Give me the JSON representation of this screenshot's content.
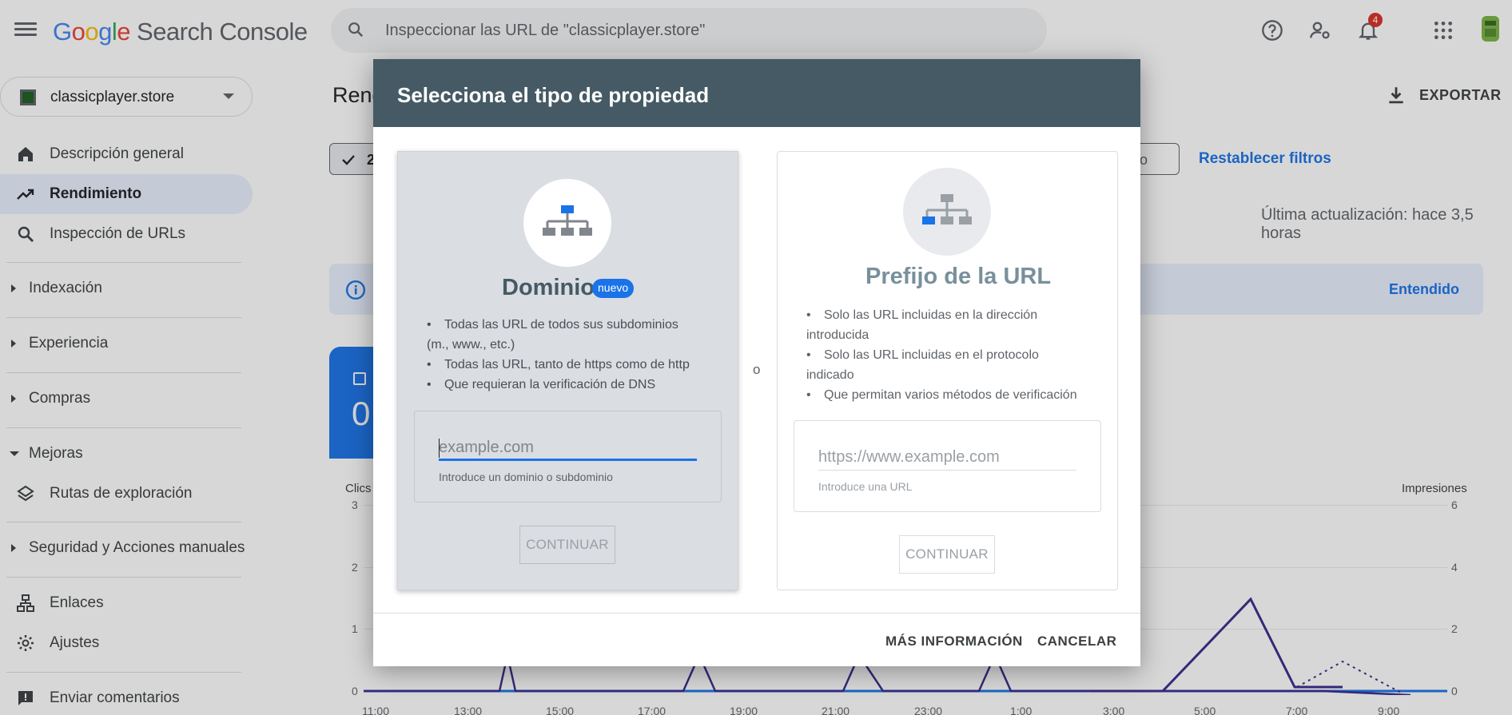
{
  "app": {
    "logo_letters": [
      "G",
      "o",
      "o",
      "g",
      "l",
      "e"
    ],
    "product": "Search Console",
    "notification_count": "4"
  },
  "search": {
    "placeholder": "Inspeccionar las URL de \"classicplayer.store\""
  },
  "property": {
    "name": "classicplayer.store"
  },
  "sidebar": {
    "items": [
      {
        "label": "Descripción general",
        "icon": "home-icon"
      },
      {
        "label": "Rendimiento",
        "icon": "trending-up-icon"
      },
      {
        "label": "Inspección de URLs",
        "icon": "search-icon"
      }
    ],
    "groups": [
      {
        "label": "Indexación"
      },
      {
        "label": "Experiencia"
      },
      {
        "label": "Compras"
      },
      {
        "label": "Mejoras"
      },
      {
        "label": "Seguridad y Acciones manuales"
      }
    ],
    "sub_items": [
      {
        "label": "Rutas de exploración",
        "icon": "layers-icon"
      }
    ],
    "bottom_items": [
      {
        "label": "Enlaces",
        "icon": "sitemap-icon"
      },
      {
        "label": "Ajustes",
        "icon": "gear-icon"
      },
      {
        "label": "Enviar comentarios",
        "icon": "feedback-icon"
      }
    ]
  },
  "main": {
    "title": "Rend",
    "export_label": "EXPORTAR",
    "filter_chip_label": "2",
    "filter_chip_right_label": "ltro",
    "reset_filters_label": "Restablecer filtros",
    "last_update": "Última actualización: hace 3,5 horas",
    "banner_action": "Entendido",
    "metric_value": "0"
  },
  "chart_data": {
    "type": "line",
    "left_axis_label": "Clics",
    "right_axis_label": "Impresiones",
    "left_ticks": [
      "3",
      "2",
      "1",
      "0"
    ],
    "right_ticks": [
      "6",
      "4",
      "2",
      "0"
    ],
    "x": [
      "11:00",
      "13:00",
      "15:00",
      "17:00",
      "19:00",
      "21:00",
      "23:00",
      "1:00",
      "3:00",
      "5:00",
      "7:00",
      "9:00"
    ],
    "ylim_left": [
      0,
      3
    ],
    "ylim_right": [
      0,
      6
    ],
    "colors": {
      "clicks": "#1a73e8",
      "impressions": "#3b2a8c"
    }
  },
  "dialog": {
    "title": "Selecciona el tipo de propiedad",
    "separator": "o",
    "more_info_label": "MÁS INFORMACIÓN",
    "cancel_label": "CANCELAR",
    "domain": {
      "title": "Dominio",
      "badge": "nuevo",
      "features": [
        "Todas las URL de todos sus subdominios",
        "(m., www., etc.)",
        "Todas las URL, tanto de https como de http",
        "Que requieran la verificación de DNS"
      ],
      "placeholder": "example.com",
      "hint": "Introduce un dominio o subdominio",
      "continue_label": "CONTINUAR"
    },
    "url_prefix": {
      "title": "Prefijo de la URL",
      "features": [
        "Solo las URL incluidas en la dirección",
        "introducida",
        "Solo las URL incluidas en el protocolo",
        "indicado",
        "Que permitan varios métodos de verificación"
      ],
      "placeholder": "https://www.example.com",
      "hint": "Introduce una URL",
      "continue_label": "CONTINUAR"
    }
  }
}
